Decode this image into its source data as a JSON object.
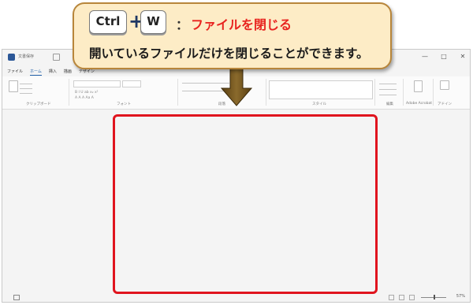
{
  "callout": {
    "key1": "Ctrl",
    "plus": "+",
    "key2": "W",
    "colon": "：",
    "action": "ファイルを閉じる",
    "description": "開いているファイルだけを閉じることができます。"
  },
  "window": {
    "title": "文書保存",
    "controls": [
      "—",
      "□",
      "✕"
    ],
    "menu": [
      "ファイル",
      "ホーム",
      "挿入",
      "描画",
      "デザイン"
    ],
    "active_menu": "ホーム",
    "groups": [
      "クリップボード",
      "フォント",
      "段落",
      "スタイル",
      "編集",
      "Adobe Acrobat",
      "アドイン"
    ],
    "zoom": "57%"
  },
  "colors": {
    "highlight": "#e0141e",
    "callout_bg": "#fdecc6",
    "callout_border": "#b8863b",
    "action_text": "#e8231f",
    "arrow": "#6b4e1d"
  },
  "icons": [
    "word-app-icon",
    "save-icon",
    "down-arrow-icon"
  ]
}
